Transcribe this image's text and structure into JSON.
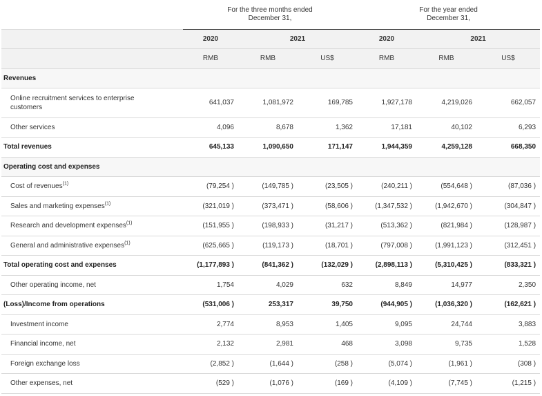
{
  "header": {
    "group_three_months": "For the three months ended\nDecember 31,",
    "group_year": "For the year ended\nDecember 31,",
    "years": [
      "2020",
      "2021",
      "2020",
      "2021"
    ],
    "currencies": [
      "RMB",
      "RMB",
      "US$",
      "RMB",
      "RMB",
      "US$"
    ]
  },
  "rows": [
    {
      "label": "Revenues",
      "style": "section",
      "values": []
    },
    {
      "label": "Online recruitment services to enterprise customers",
      "style": "indent",
      "values": [
        "641,037",
        "1,081,972",
        "169,785",
        "1,927,178",
        "4,219,026",
        "662,057"
      ]
    },
    {
      "label": "Other services",
      "style": "indent",
      "values": [
        "4,096",
        "8,678",
        "1,362",
        "17,181",
        "40,102",
        "6,293"
      ]
    },
    {
      "label": "Total revenues",
      "style": "total",
      "values": [
        "645,133",
        "1,090,650",
        "171,147",
        "1,944,359",
        "4,259,128",
        "668,350"
      ]
    },
    {
      "label": "Operating cost and expenses",
      "style": "section",
      "values": []
    },
    {
      "label": "Cost of revenues",
      "footnote": "(1)",
      "style": "indent",
      "values": [
        "(79,254 )",
        "(149,785 )",
        "(23,505 )",
        "(240,211 )",
        "(554,648 )",
        "(87,036 )"
      ]
    },
    {
      "label": "Sales and marketing expenses",
      "footnote": "(1)",
      "style": "indent",
      "values": [
        "(321,019 )",
        "(373,471 )",
        "(58,606 )",
        "(1,347,532 )",
        "(1,942,670 )",
        "(304,847 )"
      ]
    },
    {
      "label": "Research and development expenses",
      "footnote": "(1)",
      "style": "indent",
      "values": [
        "(151,955 )",
        "(198,933 )",
        "(31,217 )",
        "(513,362 )",
        "(821,984 )",
        "(128,987 )"
      ]
    },
    {
      "label": "General and administrative expenses",
      "footnote": "(1)",
      "style": "indent",
      "values": [
        "(625,665 )",
        "(119,173 )",
        "(18,701 )",
        "(797,008 )",
        "(1,991,123 )",
        "(312,451 )"
      ]
    },
    {
      "label": "Total operating cost and expenses",
      "style": "total",
      "values": [
        "(1,177,893 )",
        "(841,362 )",
        "(132,029 )",
        "(2,898,113 )",
        "(5,310,425 )",
        "(833,321 )"
      ]
    },
    {
      "label": "Other operating income, net",
      "style": "indent",
      "values": [
        "1,754",
        "4,029",
        "632",
        "8,849",
        "14,977",
        "2,350"
      ]
    },
    {
      "label": "(Loss)/Income from operations",
      "style": "total",
      "values": [
        "(531,006 )",
        "253,317",
        "39,750",
        "(944,905 )",
        "(1,036,320 )",
        "(162,621 )"
      ]
    },
    {
      "label": "Investment income",
      "style": "indent",
      "values": [
        "2,774",
        "8,953",
        "1,405",
        "9,095",
        "24,744",
        "3,883"
      ]
    },
    {
      "label": "Financial income, net",
      "style": "indent",
      "values": [
        "2,132",
        "2,981",
        "468",
        "3,098",
        "9,735",
        "1,528"
      ]
    },
    {
      "label": "Foreign exchange loss",
      "style": "indent",
      "values": [
        "(2,852 )",
        "(1,644 )",
        "(258 )",
        "(5,074 )",
        "(1,961 )",
        "(308 )"
      ]
    },
    {
      "label": "Other expenses, net",
      "style": "indent",
      "values": [
        "(529 )",
        "(1,076 )",
        "(169 )",
        "(4,109 )",
        "(7,745 )",
        "(1,215 )"
      ]
    }
  ]
}
